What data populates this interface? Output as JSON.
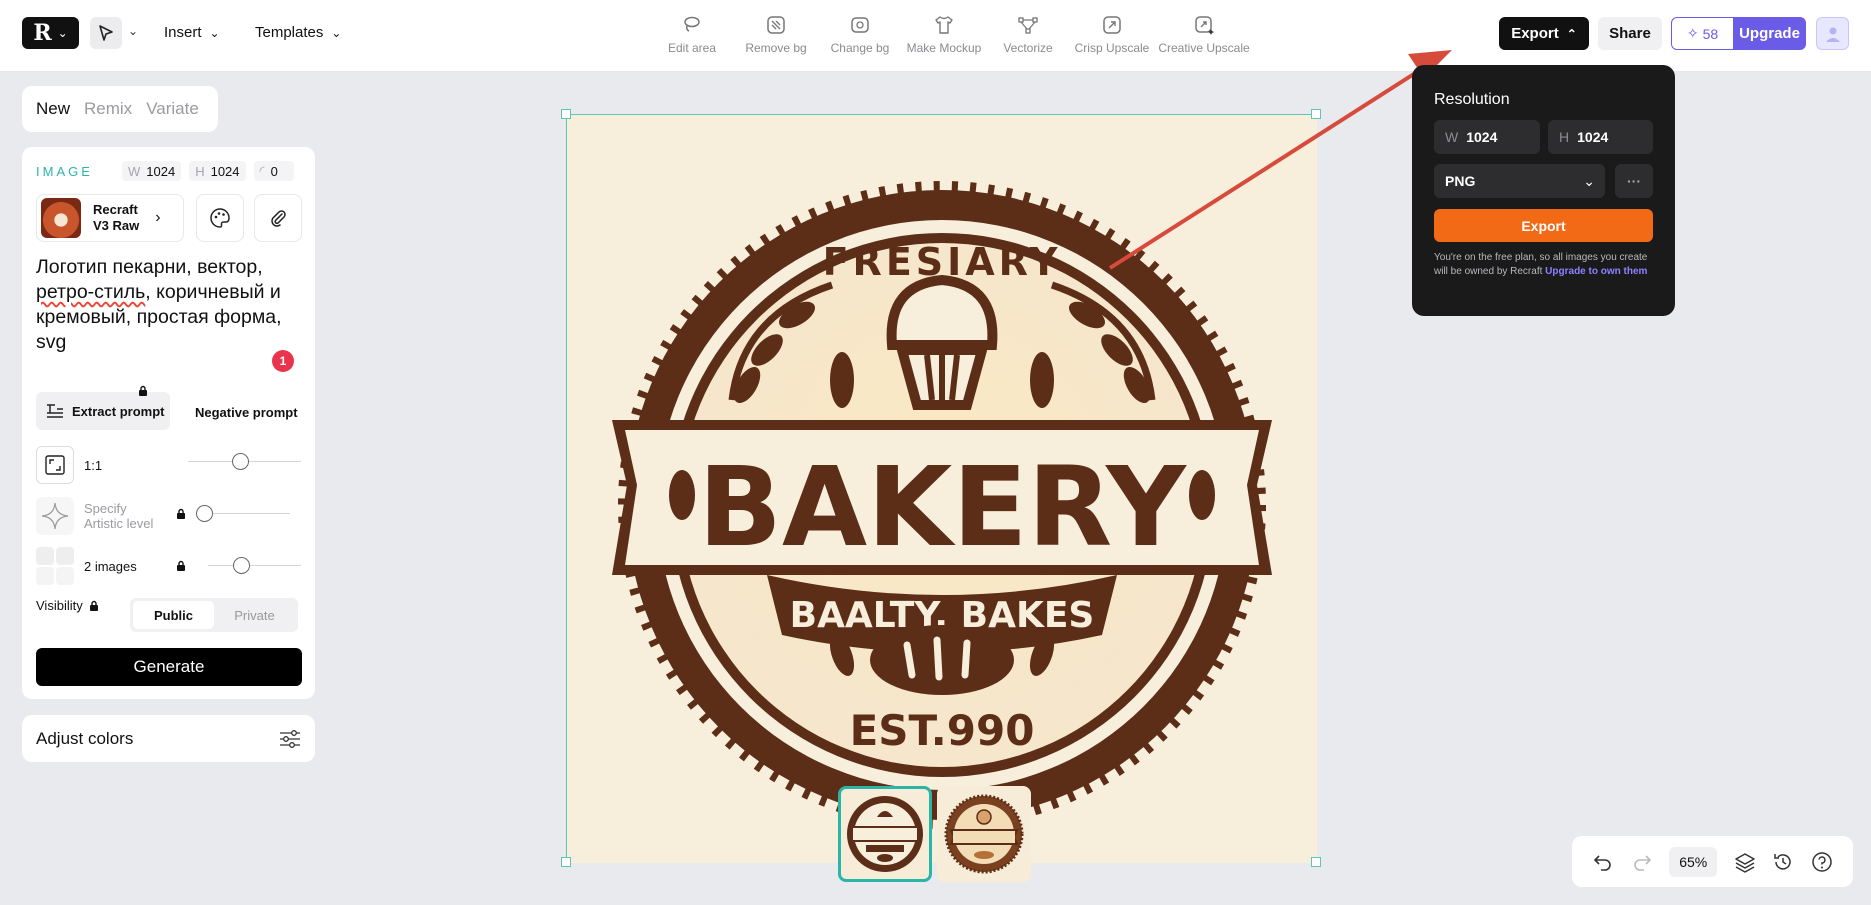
{
  "topbar": {
    "insert_label": "Insert",
    "templates_label": "Templates",
    "actions": [
      {
        "label": "Edit area",
        "icon": "lasso-icon"
      },
      {
        "label": "Remove bg",
        "icon": "remove-bg-icon"
      },
      {
        "label": "Change bg",
        "icon": "change-bg-icon"
      },
      {
        "label": "Make Mockup",
        "icon": "tshirt-icon"
      },
      {
        "label": "Vectorize",
        "icon": "vector-icon"
      },
      {
        "label": "Crisp Upscale",
        "icon": "upscale-icon"
      },
      {
        "label": "Creative Upscale",
        "icon": "creative-upscale-icon"
      }
    ],
    "export_label": "Export",
    "share_label": "Share",
    "credits": "58",
    "upgrade_label": "Upgrade"
  },
  "left": {
    "tabs": [
      "New",
      "Remix",
      "Variate"
    ],
    "active_tab": "New",
    "image_label": "IMAGE",
    "width_key": "W",
    "width": "1024",
    "height_key": "H",
    "height": "1024",
    "seed": "0",
    "model_name_1": "Recraft",
    "model_name_2": "V3 Raw",
    "prompt_part1": "Логотип пекарни, вектор, ",
    "prompt_underlined": "ретро-стиль",
    "prompt_part2": ", коричневый и кремовый, простая форма, svg",
    "prompt_badge": "1",
    "extract_label": "Extract prompt",
    "negative_label": "Negative prompt",
    "ratio_label": "1:1",
    "artistic_label_1": "Specify",
    "artistic_label_2": "Artistic level",
    "images_label": "2 images",
    "visibility_label": "Visibility",
    "public_label": "Public",
    "private_label": "Private",
    "generate_label": "Generate",
    "adjust_label": "Adjust colors"
  },
  "canvas": {
    "logo_top_text": "FRESIARY",
    "logo_main_text": "BAKERY",
    "logo_banner_text": "BAALTY, BAKES",
    "logo_bottom_text": "EST.990",
    "colors": {
      "brown": "#5c2d17",
      "cream": "#f7eedc",
      "selection": "#5cc5b4"
    }
  },
  "export_popover": {
    "title": "Resolution",
    "w_key": "W",
    "w_value": "1024",
    "h_key": "H",
    "h_value": "1024",
    "format": "PNG",
    "more_icon": "ellipsis-icon",
    "export_label": "Export",
    "note": "You're on the free plan, so all images you create will be owned by Recraft ",
    "note_link": "Upgrade to own them"
  },
  "bottom": {
    "zoom": "65%"
  }
}
